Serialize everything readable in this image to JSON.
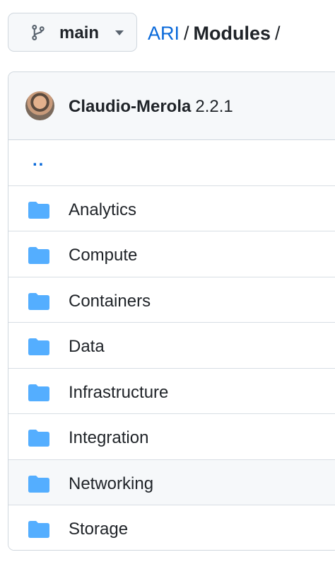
{
  "branch": {
    "label": "main"
  },
  "breadcrumb": {
    "root": "ARI",
    "separator": "/",
    "current": "Modules",
    "trailing": "/"
  },
  "commit": {
    "author": "Claudio-Merola",
    "version": "2.2.1"
  },
  "parent_link": "..",
  "folders": [
    {
      "name": "Analytics"
    },
    {
      "name": "Compute"
    },
    {
      "name": "Containers"
    },
    {
      "name": "Data"
    },
    {
      "name": "Infrastructure"
    },
    {
      "name": "Integration"
    },
    {
      "name": "Networking"
    },
    {
      "name": "Storage"
    }
  ],
  "colors": {
    "link": "#0969da",
    "folder": "#54aeff",
    "border": "#d0d7de",
    "header_bg": "#f6f8fa"
  }
}
